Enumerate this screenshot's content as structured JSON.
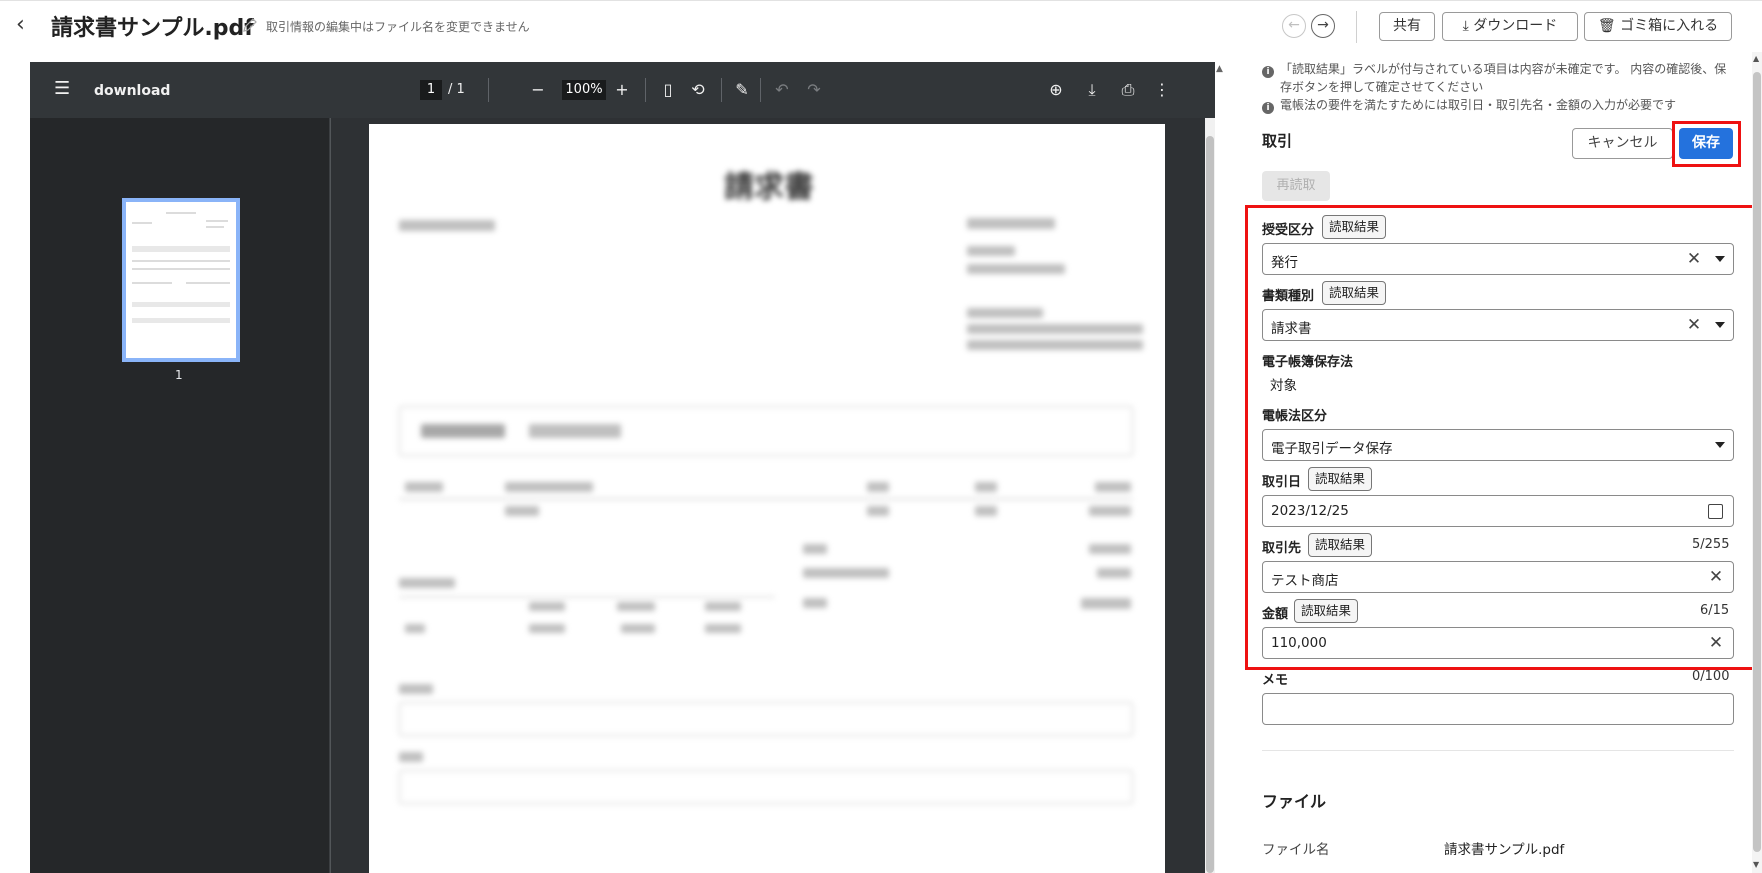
{
  "header": {
    "back_icon": "chevron-left-icon",
    "filename": "請求書サンプル.pdf",
    "rename_note": "取引情報の編集中はファイル名を変更できません",
    "prev_icon": "←",
    "next_icon": "→",
    "share_label": "共有",
    "download_label": "ダウンロード",
    "trash_label": "ゴミ箱に入れる"
  },
  "viewer": {
    "doc_name": "download",
    "current_page": "1",
    "page_total": "/  1",
    "zoom": "100%",
    "thumb_page_label": "1",
    "document_title": "請求書"
  },
  "panel": {
    "notes": [
      "「読取結果」ラベルが付与されている項目は内容が未確定です。 内容の確認後、保",
      "存ボタンを押して確定させてください",
      "電帳法の要件を満たすためには取引日・取引先名・金額の入力が必要です"
    ],
    "section_title": "取引",
    "cancel_label": "キャンセル",
    "save_label": "保存",
    "reread_label": "再読取",
    "read_result_tag": "読取結果",
    "fields": {
      "juju_kubun": {
        "label": "授受区分",
        "value": "発行"
      },
      "shorui_shubetsu": {
        "label": "書類種別",
        "value": "請求書"
      },
      "denshi_chobo": {
        "label": "電子帳簿保存法",
        "value": "対象"
      },
      "dencho_kubun": {
        "label": "電帳法区分",
        "value": "電子取引データ保存"
      },
      "torihiki_bi": {
        "label": "取引日",
        "value": "2023/12/25"
      },
      "torihiki_saki": {
        "label": "取引先",
        "value": "テスト商店",
        "counter": "5/255"
      },
      "kingaku": {
        "label": "金額",
        "value": "110,000",
        "counter": "6/15"
      },
      "memo": {
        "label": "メモ",
        "value": "",
        "counter": "0/100"
      }
    },
    "file_section_title": "ファイル",
    "file_name_key": "ファイル名",
    "file_name_value": "請求書サンプル.pdf"
  },
  "colors": {
    "save_button": "#2472dd",
    "highlight": "#ee1111",
    "viewer_toolbar": "#323639"
  }
}
